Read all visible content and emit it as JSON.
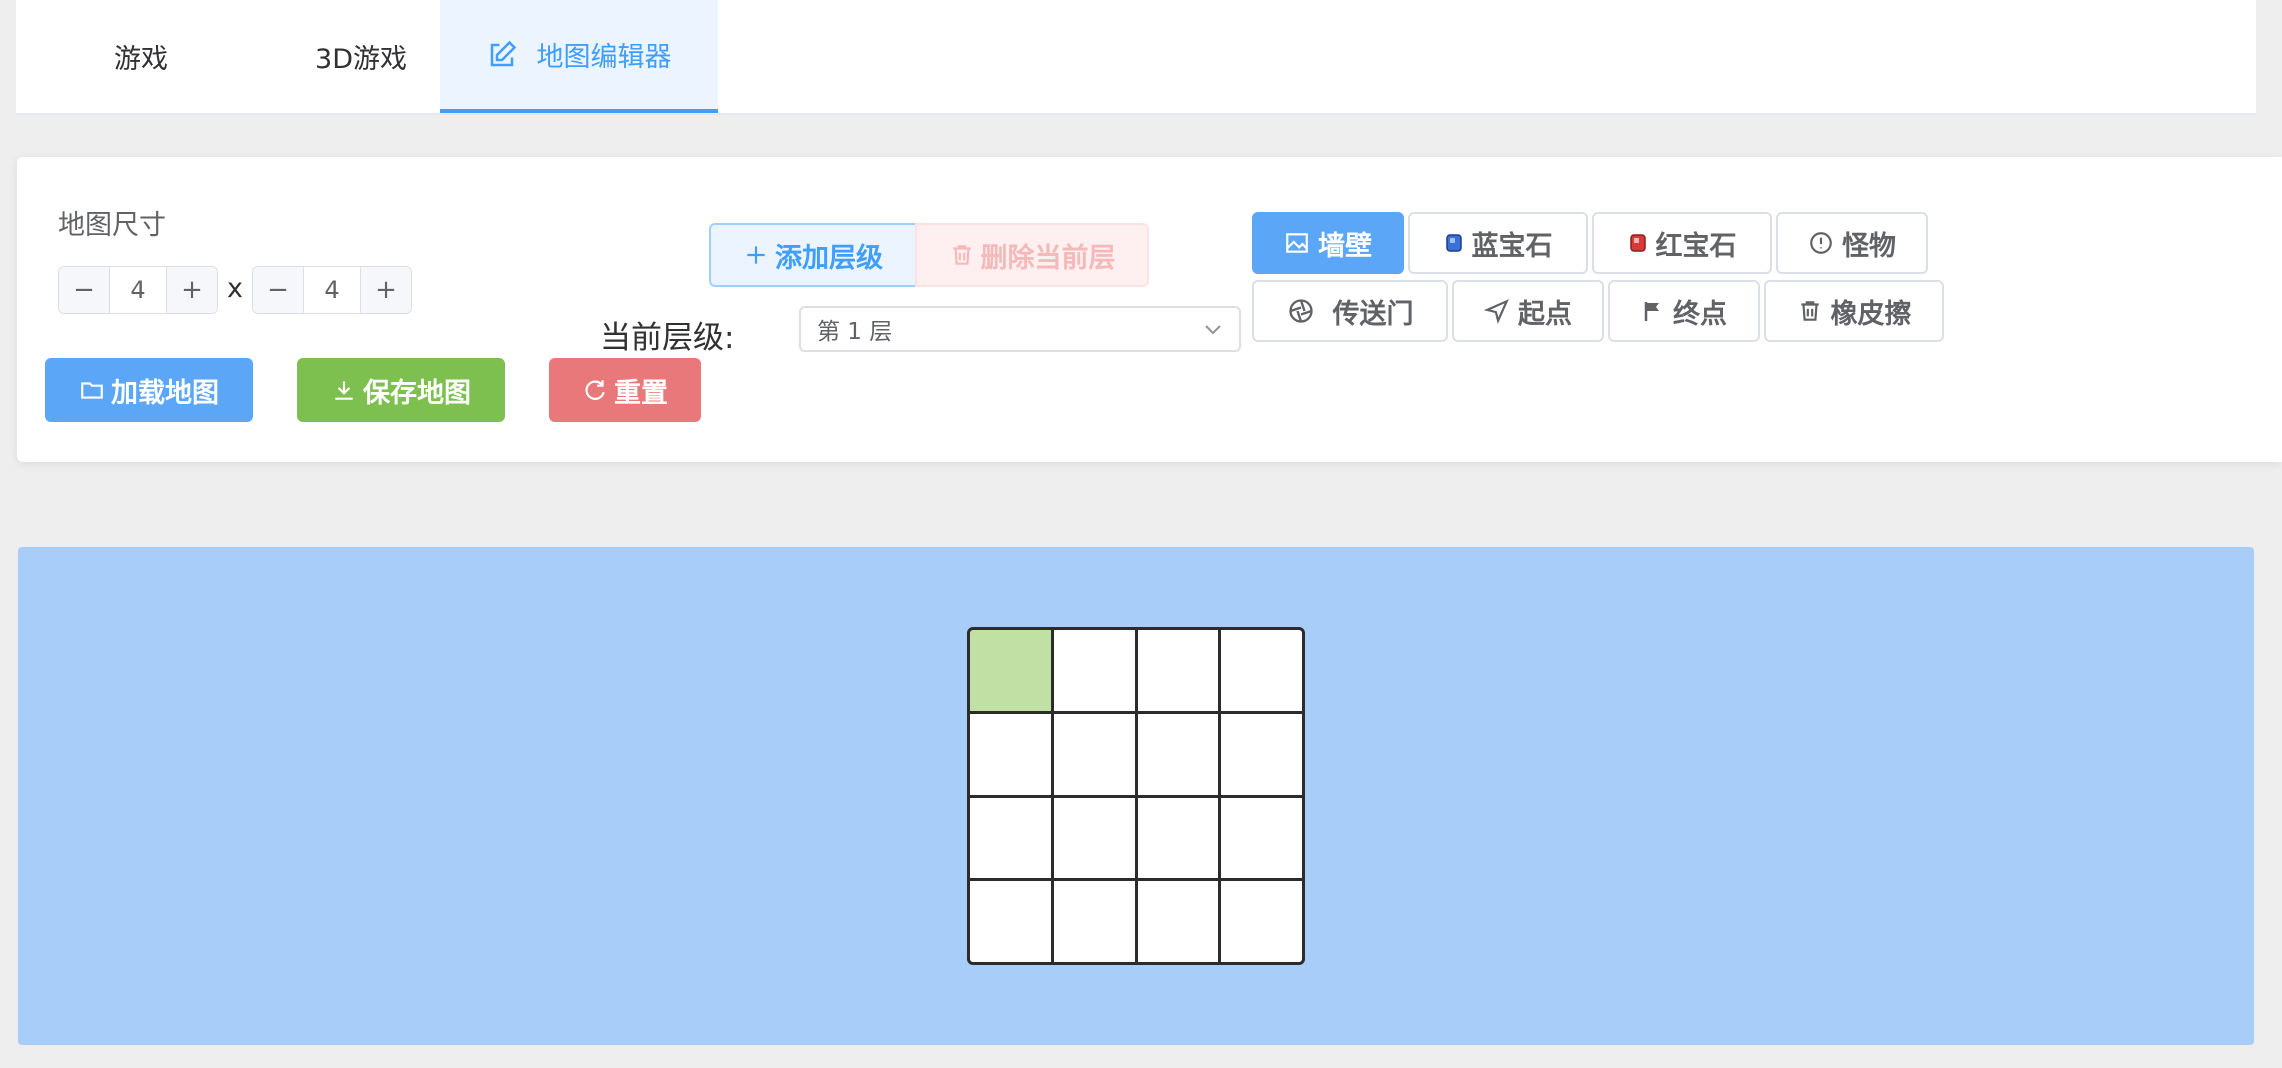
{
  "tabs": [
    {
      "label": "游戏",
      "active": false
    },
    {
      "label": "3D游戏",
      "active": false
    },
    {
      "label": "地图编辑器",
      "active": true,
      "icon": "edit-icon"
    }
  ],
  "map_size": {
    "label": "地图尺寸",
    "width": "4",
    "height": "4",
    "separator": "x"
  },
  "file_buttons": {
    "load": "加载地图",
    "save": "保存地图",
    "reset": "重置"
  },
  "layers": {
    "add": "添加层级",
    "delete": "删除当前层",
    "current_label": "当前层级:",
    "current_value": "第 1 层"
  },
  "tools": {
    "wall": "墙壁",
    "blue_gem": "蓝宝石",
    "red_gem": "红宝石",
    "monster": "怪物",
    "portal": "传送门",
    "start": "起点",
    "end": "终点",
    "eraser": "橡皮擦",
    "selected": "wall"
  },
  "grid": {
    "rows": 4,
    "cols": 4,
    "cells": [
      [
        "start",
        "empty",
        "empty",
        "empty"
      ],
      [
        "empty",
        "empty",
        "empty",
        "empty"
      ],
      [
        "empty",
        "empty",
        "empty",
        "empty"
      ],
      [
        "empty",
        "empty",
        "empty",
        "empty"
      ]
    ]
  },
  "colors": {
    "accent": "#409eff",
    "map_background": "#a8cdf9",
    "start_cell": "#c1e0a3"
  }
}
